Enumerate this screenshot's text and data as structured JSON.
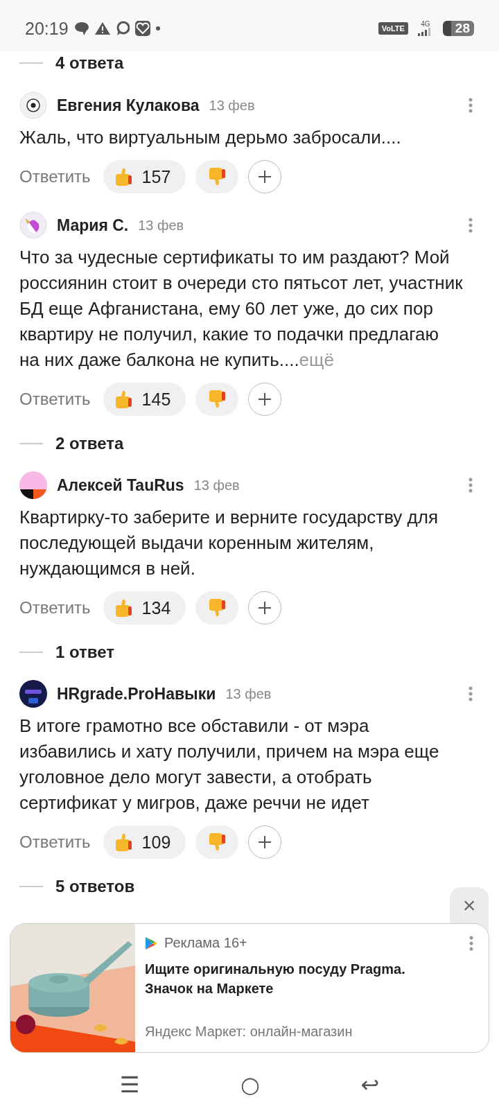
{
  "status_bar": {
    "time": "20:19",
    "network": "VoLTE",
    "signal": "4G",
    "battery": "28"
  },
  "top_replies": "4 ответа",
  "comments": [
    {
      "author": "Евгения Кулакова",
      "date": "13 фев",
      "text": "Жаль, что виртуальным дерьмо забросали....",
      "reply": "Ответить",
      "likes": "157"
    },
    {
      "author": "Мария С.",
      "date": "13 фев",
      "text": "Что за чудесные сертификаты то им раздают? Мой россиянин стоит в очереди сто пятьсот лет, участник БД еще Афганистана, ему 60 лет уже, до сих пор квартиру не получил, какие то подачки предлагаю на них даже балкона не купить....",
      "more": "ещё",
      "reply": "Ответить",
      "likes": "145",
      "replies": "2 ответа"
    },
    {
      "author": "Алексей TauRus",
      "date": "13 фев",
      "text": "Квартирку-то заберите и верните государству для последующей выдачи коренным жителям, нуждающимся в ней.",
      "reply": "Ответить",
      "likes": "134",
      "replies": "1 ответ"
    },
    {
      "author": "HRgrade.ProНавыки",
      "date": "13 фев",
      "text": "В итоге грамотно все обставили - от мэра избавились и хату получили, причем на мэра еще уголовное дело могут завести, а отобрать сертификат у мигров, даже реччи не идет",
      "reply": "Ответить",
      "likes": "109",
      "replies": "5 ответов"
    }
  ],
  "ad": {
    "label": "Реклама 16+",
    "title": "Ищите оригинальную посуду Pragma. Значок на Маркете",
    "source": "Яндекс Маркет: онлайн-магазин",
    "close": "×"
  },
  "nav": [
    "☰",
    "○",
    "↩"
  ]
}
